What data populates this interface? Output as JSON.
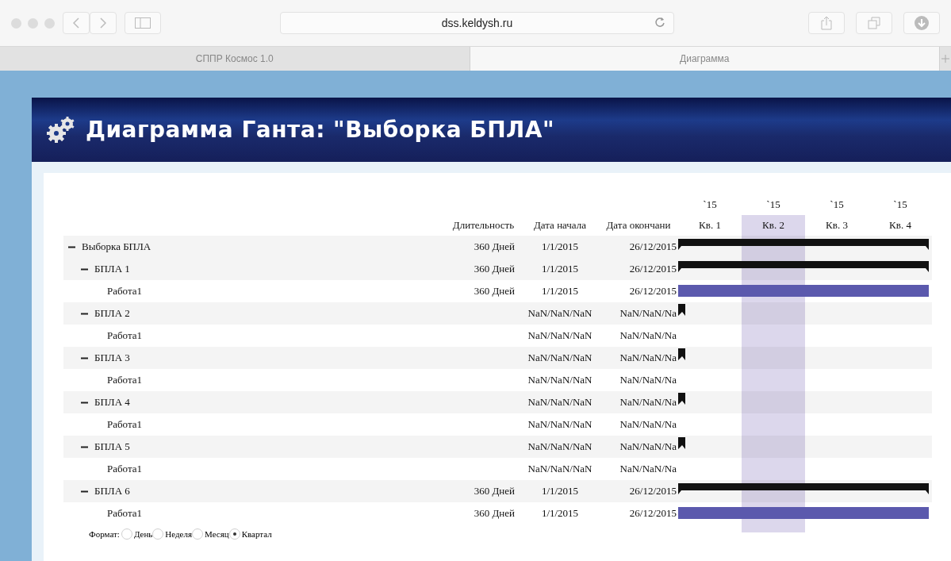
{
  "browser": {
    "url": "dss.keldysh.ru",
    "tabs": [
      {
        "label": "СППР Космос 1.0",
        "selected": false
      },
      {
        "label": "Диаграмма",
        "selected": true
      }
    ]
  },
  "header": {
    "title": "Диаграмма Ганта: \"Выборка БПЛА\""
  },
  "gantt": {
    "columns": [
      "Длительность",
      "Дата начала",
      "Дата окончани"
    ],
    "periods": [
      {
        "year": "`15",
        "label": "Кв. 1",
        "selected": false
      },
      {
        "year": "`15",
        "label": "Кв. 2",
        "selected": true
      },
      {
        "year": "`15",
        "label": "Кв. 3",
        "selected": false
      },
      {
        "year": "`15",
        "label": "Кв. 4",
        "selected": false
      }
    ],
    "rows": [
      {
        "name": "Выборка БПЛА",
        "kind": "summary",
        "expanded": true,
        "duration": "360 Дней",
        "start": "1/1/2015",
        "end": "26/12/2015",
        "children": [
          {
            "name": "БПЛА 1",
            "kind": "summary",
            "expanded": true,
            "duration": "360 Дней",
            "start": "1/1/2015",
            "end": "26/12/2015",
            "children": [
              {
                "name": "Работа1",
                "kind": "task",
                "duration": "360 Дней",
                "start": "1/1/2015",
                "end": "26/12/2015"
              }
            ]
          },
          {
            "name": "БПЛА 2",
            "kind": "flagged",
            "expanded": true,
            "start": "NaN/NaN/NaN",
            "end": "NaN/NaN/Na",
            "children": [
              {
                "name": "Работа1",
                "kind": "undated",
                "start": "NaN/NaN/NaN",
                "end": "NaN/NaN/Na"
              }
            ]
          },
          {
            "name": "БПЛА 3",
            "kind": "flagged",
            "expanded": true,
            "start": "NaN/NaN/NaN",
            "end": "NaN/NaN/Na",
            "children": [
              {
                "name": "Работа1",
                "kind": "undated",
                "start": "NaN/NaN/NaN",
                "end": "NaN/NaN/Na"
              }
            ]
          },
          {
            "name": "БПЛА 4",
            "kind": "flagged",
            "expanded": true,
            "start": "NaN/NaN/NaN",
            "end": "NaN/NaN/Na",
            "children": [
              {
                "name": "Работа1",
                "kind": "undated",
                "start": "NaN/NaN/NaN",
                "end": "NaN/NaN/Na"
              }
            ]
          },
          {
            "name": "БПЛА 5",
            "kind": "flagged",
            "expanded": true,
            "start": "NaN/NaN/NaN",
            "end": "NaN/NaN/Na",
            "children": [
              {
                "name": "Работа1",
                "kind": "undated",
                "start": "NaN/NaN/NaN",
                "end": "NaN/NaN/Na"
              }
            ]
          },
          {
            "name": "БПЛА 6",
            "kind": "summary",
            "expanded": true,
            "duration": "360 Дней",
            "start": "1/1/2015",
            "end": "26/12/2015",
            "children": [
              {
                "name": "Работа1",
                "kind": "task",
                "duration": "360 Дней",
                "start": "1/1/2015",
                "end": "26/12/2015"
              }
            ]
          }
        ]
      }
    ]
  },
  "format": {
    "label": "Формат:",
    "options": [
      {
        "label": "День",
        "selected": false
      },
      {
        "label": "Неделя",
        "selected": false
      },
      {
        "label": "Месяц",
        "selected": false
      },
      {
        "label": "Квартал",
        "selected": true
      }
    ]
  }
}
